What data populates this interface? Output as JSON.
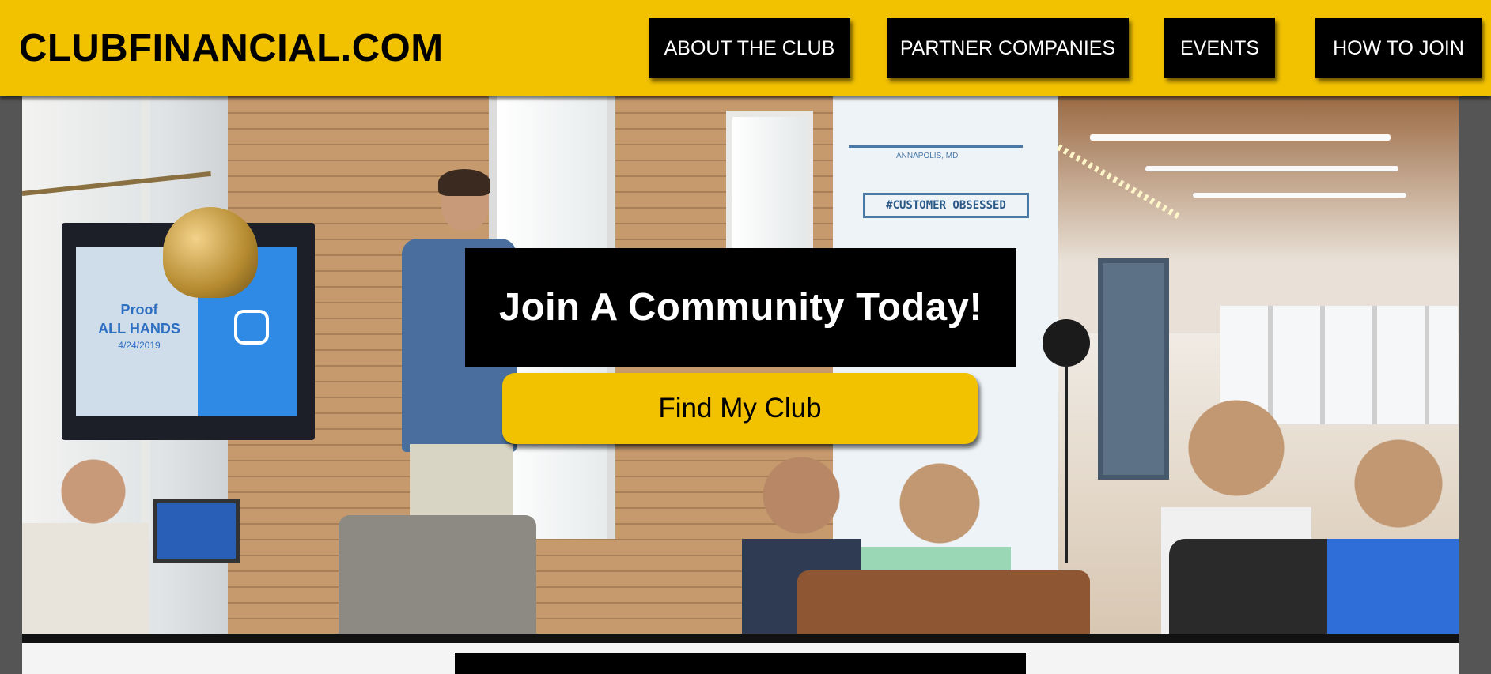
{
  "header": {
    "logo_text": "CLUBFINANCIAL.COM",
    "nav": [
      {
        "label": "ABOUT THE CLUB"
      },
      {
        "label": "PARTNER COMPANIES"
      },
      {
        "label": "EVENTS"
      },
      {
        "label": "HOW TO JOIN"
      }
    ]
  },
  "hero": {
    "headline": "Join A Community Today!",
    "cta_label": "Find My Club",
    "image": {
      "screen_text_line1": "Proof",
      "screen_text_line2": "ALL HANDS",
      "screen_text_line3": "4/24/2019",
      "mural_text": "#CUSTOMER OBSESSED",
      "mural_caption": "ANNAPOLIS, MD"
    }
  },
  "colors": {
    "brand_yellow": "#f2c200",
    "black": "#000000",
    "white": "#ffffff"
  }
}
